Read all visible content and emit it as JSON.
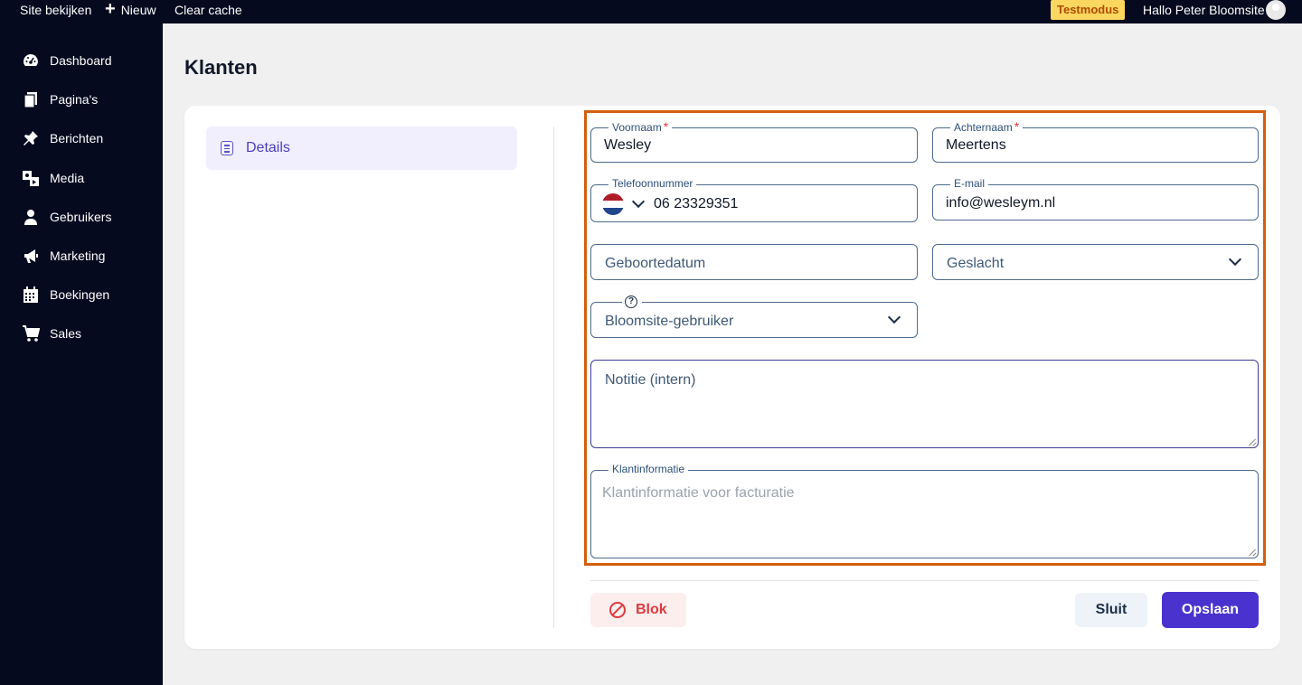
{
  "topbar": {
    "site": "Site bekijken",
    "new": "Nieuw",
    "cache": "Clear cache",
    "mode": "Testmodus",
    "hello": "Hallo Peter Bloomsite"
  },
  "sidebar": {
    "items": [
      {
        "label": "Dashboard",
        "icon": "dashboard-icon"
      },
      {
        "label": "Pagina's",
        "icon": "pages-icon"
      },
      {
        "label": "Berichten",
        "icon": "pin-icon"
      },
      {
        "label": "Media",
        "icon": "media-icon"
      },
      {
        "label": "Gebruikers",
        "icon": "user-icon"
      },
      {
        "label": "Marketing",
        "icon": "megaphone-icon"
      },
      {
        "label": "Boekingen",
        "icon": "calendar-icon"
      },
      {
        "label": "Sales",
        "icon": "cart-icon"
      }
    ]
  },
  "page": {
    "title": "Klanten",
    "tab": "Details"
  },
  "form": {
    "voornaam": {
      "label": "Voornaam",
      "value": "Wesley",
      "required": "*"
    },
    "achternaam": {
      "label": "Achternaam",
      "value": "Meertens",
      "required": "*"
    },
    "telefoon": {
      "label": "Telefoonnummer",
      "value": "06 23329351",
      "country": "NL"
    },
    "email": {
      "label": "E-mail",
      "value": "info@wesleym.nl"
    },
    "geboortedatum": {
      "placeholder": "Geboortedatum"
    },
    "geslacht": {
      "placeholder": "Geslacht"
    },
    "gebruiker": {
      "placeholder": "Bloomsite-gebruiker",
      "help": "?"
    },
    "notitie": {
      "placeholder": "Notitie (intern)"
    },
    "klantinfo": {
      "label": "Klantinformatie",
      "placeholder": "Klantinformatie voor facturatie"
    }
  },
  "actions": {
    "block": "Blok",
    "close": "Sluit",
    "save": "Opslaan"
  },
  "colors": {
    "sidebar_bg": "#050a1f",
    "accent": "#4a32cf",
    "danger": "#e0393e",
    "highlight": "#d35e0e",
    "testmode": "#fbd760"
  }
}
